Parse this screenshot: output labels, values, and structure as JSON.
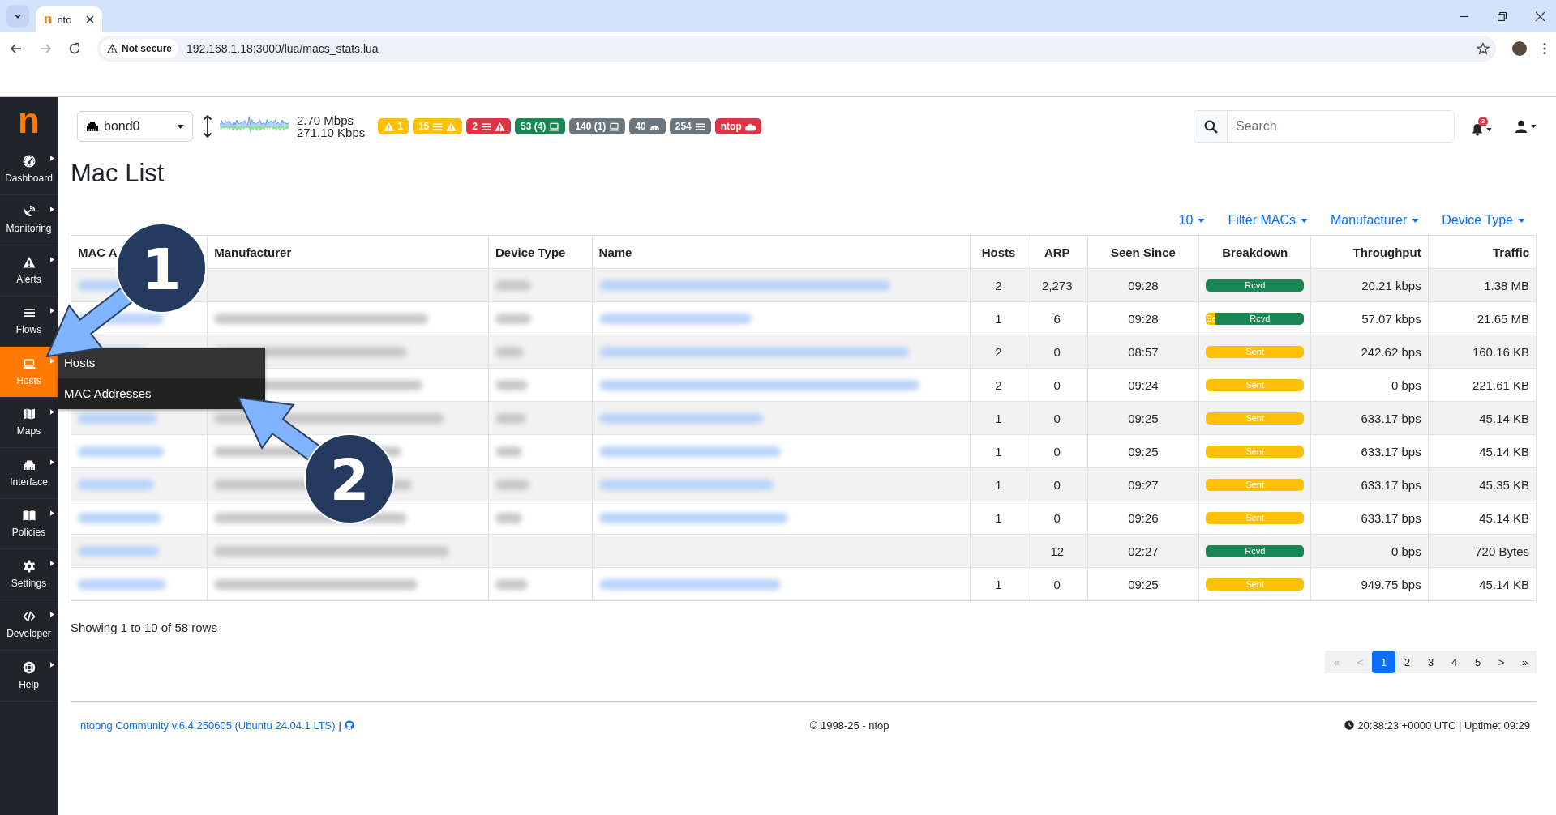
{
  "browser": {
    "favicon": "n",
    "tab_title": "nto",
    "security_label": "Not secure",
    "url": "192.168.1.18:3000/lua/macs_stats.lua"
  },
  "sidebar": {
    "logo": "n",
    "items": [
      {
        "label": "Dashboard",
        "selected": false
      },
      {
        "label": "Monitoring",
        "selected": false
      },
      {
        "label": "Alerts",
        "selected": false
      },
      {
        "label": "Flows",
        "selected": false
      },
      {
        "label": "Hosts",
        "selected": true
      },
      {
        "label": "Maps",
        "selected": false
      },
      {
        "label": "Interface",
        "selected": false
      },
      {
        "label": "Policies",
        "selected": false
      },
      {
        "label": "Settings",
        "selected": false
      },
      {
        "label": "Developer",
        "selected": false
      },
      {
        "label": "Help",
        "selected": false
      }
    ]
  },
  "submenu": {
    "items": [
      {
        "label": "Hosts",
        "highlighted": true
      },
      {
        "label": "MAC Addresses",
        "highlighted": false
      }
    ]
  },
  "header": {
    "interface": "bond0",
    "upload": "2.70 Mbps",
    "download": "271.10 Kbps",
    "badges": [
      {
        "text": "1",
        "color": "#ffc107"
      },
      {
        "text": "15",
        "color": "#ffc107"
      },
      {
        "text": "2",
        "color": "#dc3545"
      },
      {
        "text": "53 (4)",
        "color": "#198754"
      },
      {
        "text": "140 (1)",
        "color": "#6c757d"
      },
      {
        "text": "40",
        "color": "#6c757d"
      },
      {
        "text": "254",
        "color": "#6c757d"
      },
      {
        "text": "ntop",
        "color": "#dc3545"
      }
    ],
    "search_placeholder": "Search",
    "notification_count": "3"
  },
  "page": {
    "title": "Mac List",
    "filters": [
      "10",
      "Filter MACs",
      "Manufacturer",
      "Device Type"
    ]
  },
  "table": {
    "columns": [
      "MAC A",
      "Manufacturer",
      "Device Type",
      "Name",
      "Hosts",
      "ARP",
      "Seen Since",
      "Breakdown",
      "Throughput",
      "Traffic"
    ],
    "rows": [
      {
        "hosts": "2",
        "arp": "2,273",
        "seen_since": "09:28",
        "breakdown": [
          {
            "kind": "rcvd",
            "label": "Rcvd",
            "level": 1
          }
        ],
        "throughput": "20.21 kbps",
        "traffic": "1.38 MB"
      },
      {
        "hosts": "1",
        "arp": "6",
        "seen_since": "09:28",
        "breakdown": [
          {
            "kind": "sent",
            "label": "Se",
            "level": 0.1
          },
          {
            "kind": "rcvd",
            "label": "Rcvd",
            "level": 0.9
          }
        ],
        "throughput": "57.07 kbps",
        "traffic": "21.65 MB"
      },
      {
        "hosts": "2",
        "arp": "0",
        "seen_since": "08:57",
        "breakdown": [
          {
            "kind": "sent",
            "label": "Sent",
            "level": 1
          }
        ],
        "throughput": "242.62 bps",
        "traffic": "160.16 KB"
      },
      {
        "hosts": "2",
        "arp": "0",
        "seen_since": "09:24",
        "breakdown": [
          {
            "kind": "sent",
            "label": "Sent",
            "level": 1
          }
        ],
        "throughput": "0 bps",
        "traffic": "221.61 KB"
      },
      {
        "hosts": "1",
        "arp": "0",
        "seen_since": "09:25",
        "breakdown": [
          {
            "kind": "sent",
            "label": "Sent",
            "level": 1
          }
        ],
        "throughput": "633.17 bps",
        "traffic": "45.14 KB"
      },
      {
        "hosts": "1",
        "arp": "0",
        "seen_since": "09:25",
        "breakdown": [
          {
            "kind": "sent",
            "label": "Sent",
            "level": 1
          }
        ],
        "throughput": "633.17 bps",
        "traffic": "45.14 KB"
      },
      {
        "hosts": "1",
        "arp": "0",
        "seen_since": "09:27",
        "breakdown": [
          {
            "kind": "sent",
            "label": "Sent",
            "level": 1
          }
        ],
        "throughput": "633.17 bps",
        "traffic": "45.35 KB"
      },
      {
        "hosts": "1",
        "arp": "0",
        "seen_since": "09:26",
        "breakdown": [
          {
            "kind": "sent",
            "label": "Sent",
            "level": 1
          }
        ],
        "throughput": "633.17 bps",
        "traffic": "45.14 KB"
      },
      {
        "arp": "12",
        "seen_since": "02:27",
        "breakdown": [
          {
            "kind": "rcvd",
            "label": "Rcvd",
            "level": 1
          }
        ],
        "throughput": "0 bps",
        "traffic": "720 Bytes"
      },
      {
        "hosts": "1",
        "arp": "0",
        "seen_since": "09:25",
        "breakdown": [
          {
            "kind": "sent",
            "label": "Sent",
            "level": 1
          }
        ],
        "throughput": "949.75 bps",
        "traffic": "45.14 KB"
      }
    ]
  },
  "summary": "Showing 1 to 10 of 58 rows",
  "pagination": [
    {
      "label": "«",
      "disabled": true,
      "selected": false
    },
    {
      "label": "<",
      "disabled": true,
      "selected": false
    },
    {
      "label": "1",
      "disabled": false,
      "selected": true
    },
    {
      "label": "2",
      "disabled": false,
      "selected": false
    },
    {
      "label": "3",
      "disabled": false,
      "selected": false
    },
    {
      "label": "4",
      "disabled": false,
      "selected": false
    },
    {
      "label": "5",
      "disabled": false,
      "selected": false
    },
    {
      "label": ">",
      "disabled": false,
      "selected": false
    },
    {
      "label": "»",
      "disabled": false,
      "selected": false
    }
  ],
  "footer": {
    "version": "ntopng Community v.6.4.250605 (Ubuntu 24.04.1 LTS)",
    "separator": "|",
    "copyright": "© 1998-25 - ntop",
    "clock": "20:38:23 +0000 UTC | Uptime: 09:29"
  },
  "annotations": [
    {
      "number": "1"
    },
    {
      "number": "2"
    }
  ]
}
